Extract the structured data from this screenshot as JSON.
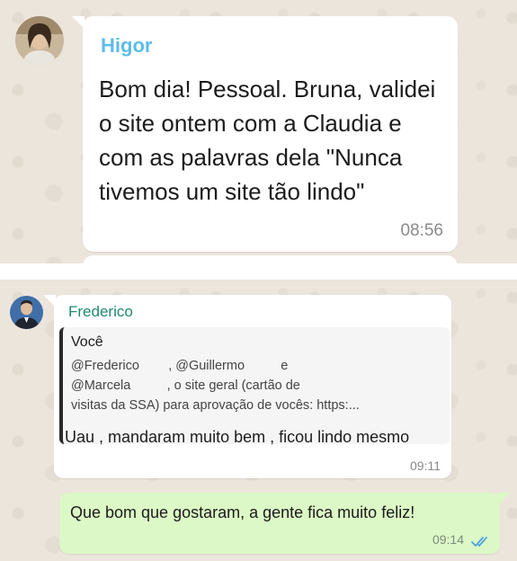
{
  "chat_top": {
    "sender": "Higor",
    "message": "Bom dia! Pessoal. Bruna, validei o site ontem com a Claudia e com as palavras dela \"Nunca tivemos um site tão lindo\"",
    "time": "08:56"
  },
  "chat_bottom": {
    "incoming": {
      "sender": "Frederico",
      "quote_author": "Você",
      "quote_text": "@Frederico        , @Guillermo          e\n@Marcela          , o site geral (cartão de\nvisitas da SSA) para aprovação de vocês: https:...",
      "message": "Uau , mandaram muito bem , ficou lindo mesmo",
      "time": "09:11"
    },
    "outgoing": {
      "message": "Que bom que gostaram, a gente fica muito feliz!",
      "time": "09:14",
      "status_icon": "double-check-icon",
      "status_color": "#4fa3e0"
    }
  },
  "colors": {
    "chat_background": "#ece5dc",
    "incoming_bubble": "#ffffff",
    "outgoing_bubble": "#dcf8c6",
    "sender_higor": "#5dbde8",
    "sender_frederico": "#1f8a6d"
  }
}
